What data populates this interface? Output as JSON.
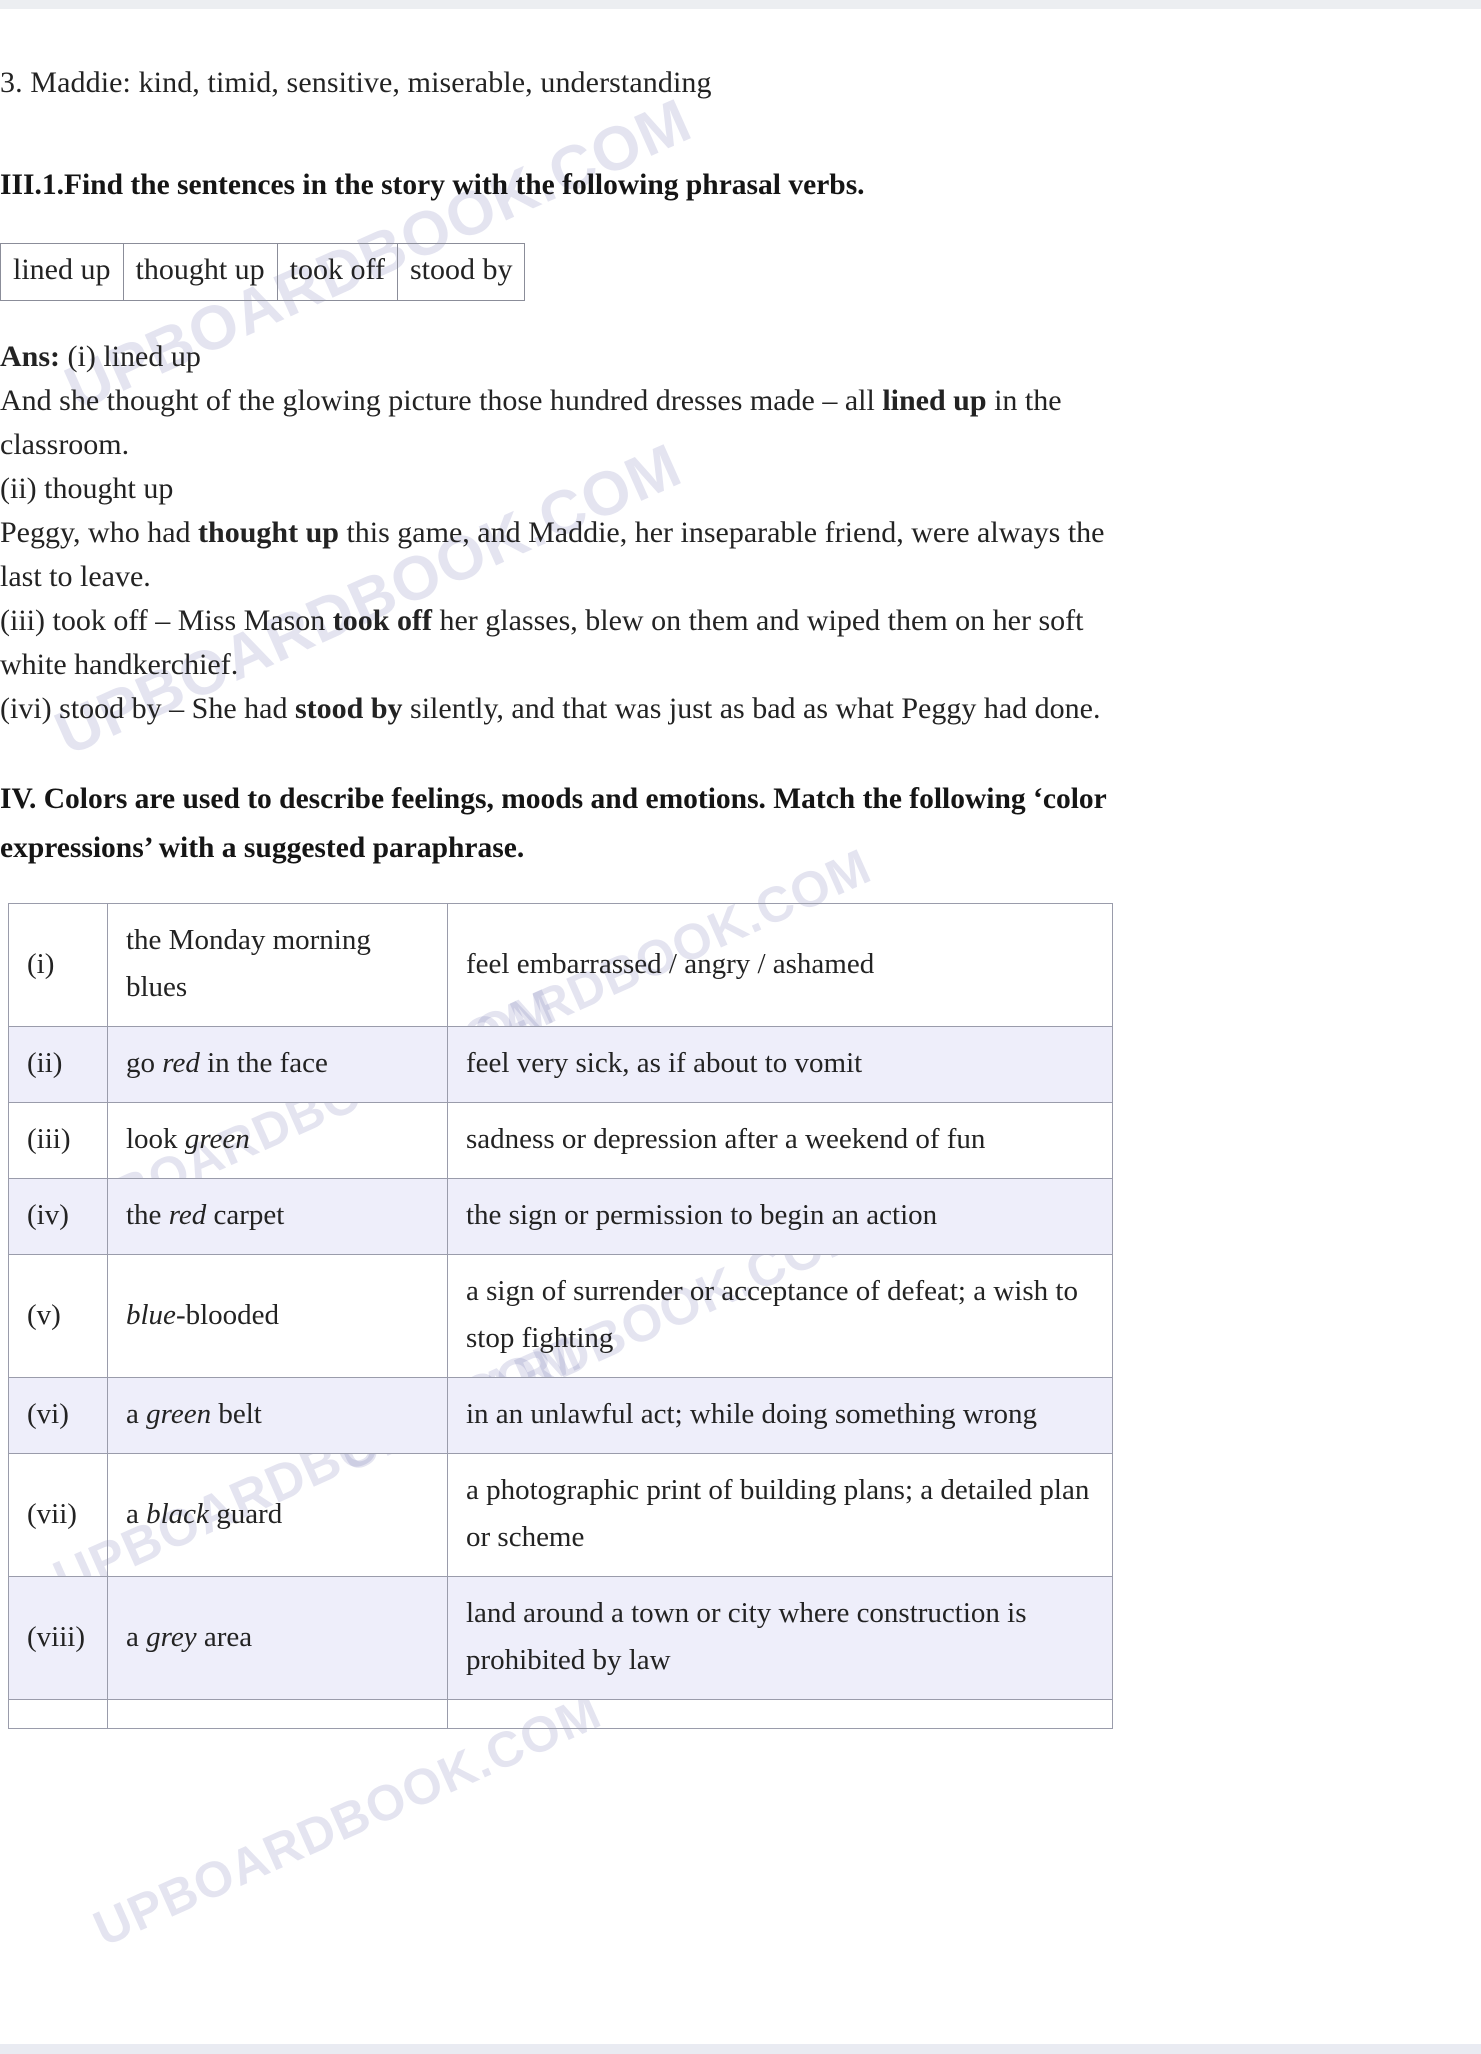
{
  "page": {
    "watermark_text": "UPBOARDBOOK.COM"
  },
  "character_line": {
    "text": "3. Maddie:  kind, timid, sensitive, miserable, understanding"
  },
  "section_iii": {
    "heading": "III.1.Find the sentences in the story with the following phrasal verbs.",
    "phrasal_verbs": [
      "lined up",
      "thought up",
      "took off",
      "stood by"
    ],
    "answers": {
      "label": "Ans:",
      "items": [
        {
          "marker": "(i) lined up",
          "body_pre": "And she thought of the glowing picture those hundred dresses made – all ",
          "body_bold": "lined up",
          "body_post": " in the classroom."
        },
        {
          "marker": "(ii) thought up",
          "body_pre": "Peggy, who had ",
          "body_bold": "thought up",
          "body_post": " this game, and Maddie, her inseparable friend, were always the last to leave."
        },
        {
          "marker": "(iii) took off – Miss Mason ",
          "body_pre": "",
          "body_bold": "took off",
          "body_post": " her glasses, blew on them and wiped them on her soft white handkerchief."
        },
        {
          "marker": "(ivi) stood by – She had ",
          "body_pre": "",
          "body_bold": "stood by",
          "body_post": " silently, and that was just as bad as what Peggy had done."
        }
      ]
    }
  },
  "section_iv": {
    "heading_line1": "IV. Colors are used to describe feelings, moods and emotions. Match the following ‘color",
    "heading_line2": "expressions’ with a suggested paraphrase.",
    "rows": [
      {
        "num": "(i)",
        "expr_pre": "the Monday morning blues",
        "expr_italic": "",
        "expr_post": "",
        "paraphrase": "feel embarrassed / angry / ashamed"
      },
      {
        "num": "(ii)",
        "expr_pre": "go ",
        "expr_italic": "red",
        "expr_post": " in the face",
        "paraphrase": "feel very sick, as if about to vomit"
      },
      {
        "num": "(iii)",
        "expr_pre": "look ",
        "expr_italic": "green",
        "expr_post": "",
        "paraphrase": "sadness or depression after a weekend of fun"
      },
      {
        "num": "(iv)",
        "expr_pre": "the ",
        "expr_italic": "red",
        "expr_post": " carpet",
        "paraphrase": "the sign or permission to begin an action"
      },
      {
        "num": "(v)",
        "expr_pre": "",
        "expr_italic": "blue",
        "expr_post": "-blooded",
        "paraphrase": "a sign of surrender or acceptance of defeat; a wish to stop fighting"
      },
      {
        "num": "(vi)",
        "expr_pre": "a ",
        "expr_italic": "green",
        "expr_post": " belt",
        "paraphrase": "in an unlawful act; while doing something wrong"
      },
      {
        "num": "(vii)",
        "expr_pre": "a ",
        "expr_italic": "black",
        "expr_post": " guard",
        "paraphrase": "a photographic print of building plans; a detailed plan or scheme"
      },
      {
        "num": "(viii)",
        "expr_pre": "a ",
        "expr_italic": "grey",
        "expr_post": " area",
        "paraphrase": "land around a town or city where construction is prohibited by law"
      },
      {
        "num": "",
        "expr_pre": "",
        "expr_italic": "",
        "expr_post": "",
        "paraphrase": ""
      }
    ]
  }
}
